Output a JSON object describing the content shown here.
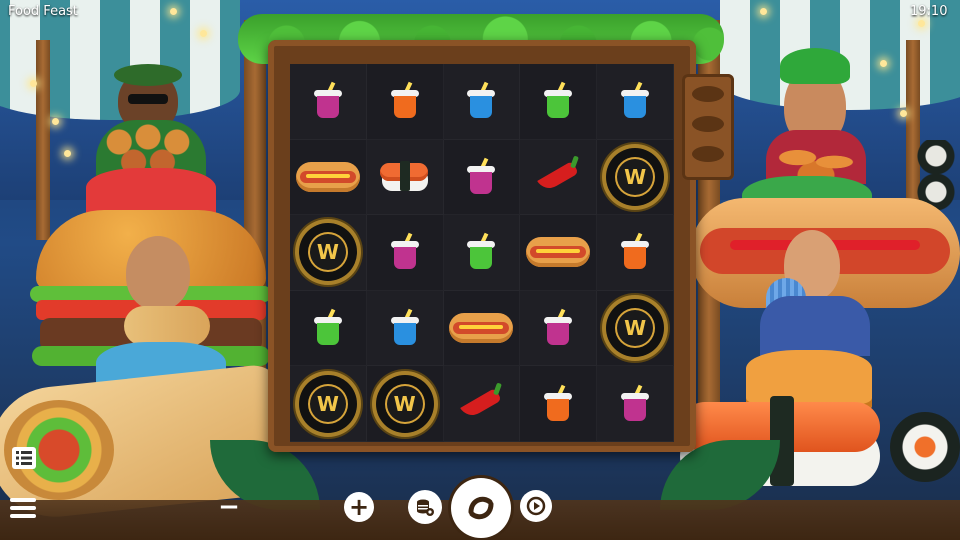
{
  "app": {
    "title": "Food Feast",
    "clock": "19:10"
  },
  "reel": {
    "rows": [
      [
        "drink-purple",
        "drink-orange",
        "drink-blue",
        "drink-green",
        "drink-blue"
      ],
      [
        "hotdog",
        "sushi",
        "drink-purple",
        "chili",
        "wild"
      ],
      [
        "wild",
        "drink-purple",
        "drink-green",
        "hotdog",
        "drink-orange"
      ],
      [
        "drink-green",
        "drink-blue",
        "hotdog",
        "drink-purple",
        "wild"
      ],
      [
        "wild",
        "wild",
        "chili",
        "drink-orange",
        "drink-purple"
      ]
    ],
    "wild_label": "W"
  },
  "controls": {
    "menu_icon": "hamburger-menu-icon",
    "paytable_icon": "paytable-list-icon",
    "minus_label": "−",
    "plus_label": "+",
    "coin_stack_icon": "coin-stack-icon",
    "spin_icon": "spin-arrows-icon",
    "autoplay_icon": "autoplay-icon"
  },
  "colors": {
    "reel_frame": "#6b3f1c",
    "reel_bg": "#1c1c22",
    "wild_gold": "#d6a43a",
    "drink_purple": "#c0338f",
    "drink_orange": "#f06b1e",
    "drink_blue": "#2a90e0",
    "drink_green": "#4cc53a"
  }
}
